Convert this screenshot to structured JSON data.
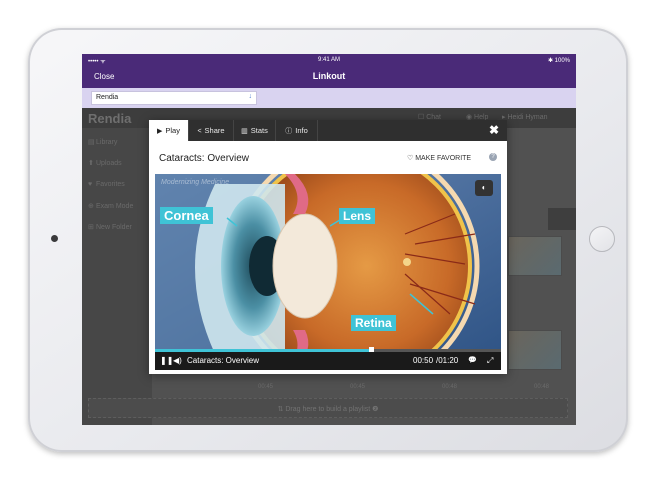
{
  "status_bar": {
    "left": "••••• ᯤ",
    "time": "9:41 AM",
    "right": "✱ 100%"
  },
  "nav": {
    "close_label": "Close",
    "title": "Linkout"
  },
  "url_field": {
    "value": "Rendia",
    "arrow": "↓"
  },
  "app": {
    "logo": "Rendia",
    "chat": "☐ Chat",
    "help": "◉ Help",
    "user": "▸ Heidi Hyman",
    "sidebar": [
      {
        "icon": "▤",
        "label": "Library"
      },
      {
        "icon": "⬆",
        "label": "Uploads"
      },
      {
        "icon": "♥",
        "label": "Favorites"
      },
      {
        "icon": "⊕",
        "label": "Exam Mode"
      },
      {
        "icon": "⊞",
        "label": "New Folder"
      }
    ],
    "times": [
      "00:45",
      "00:45",
      "00:48",
      "00:48"
    ],
    "playlist_hint": "⇅ Drag here to build a playlist ❷"
  },
  "modal": {
    "tabs": [
      {
        "icon": "▶",
        "label": "Play"
      },
      {
        "icon": "<",
        "label": "Share"
      },
      {
        "icon": "▥",
        "label": "Stats"
      },
      {
        "icon": "ⓘ",
        "label": "Info"
      }
    ],
    "close": "✖",
    "title": "Cataracts: Overview",
    "favorite_label": "♡ MAKE FAVORITE",
    "favorite_help": "?"
  },
  "video": {
    "watermark": "Modernizing Medicine",
    "labels": {
      "cornea": "Cornea",
      "lens": "Lens",
      "retina": "Retina"
    },
    "cc_icon": "◐",
    "controls": {
      "pause": "❚❚",
      "volume": "◀)",
      "title": "Cataracts: Overview",
      "current": "00:50",
      "total": "/01:20",
      "chat": "💬",
      "fullscreen": "⤢"
    },
    "progress_fraction": 0.625
  },
  "colors": {
    "brand_purple": "#4a2a78",
    "accent_cyan": "#3fc3d6"
  }
}
